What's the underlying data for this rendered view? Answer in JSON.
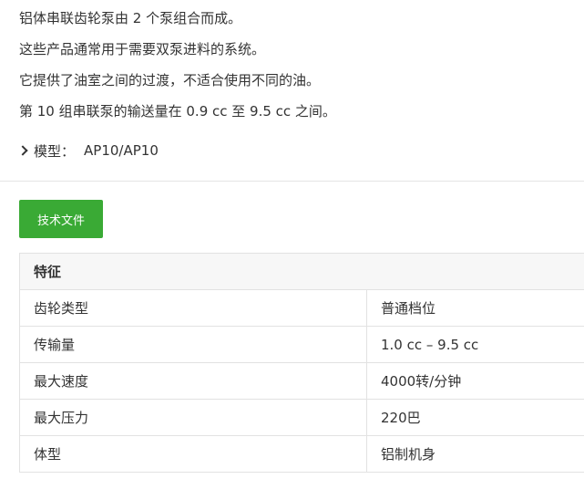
{
  "description": {
    "lines": [
      "铝体串联齿轮泵由 2 个泵组合而成。",
      "这些产品通常用于需要双泵进料的系统。",
      "它提供了油室之间的过渡，不适合使用不同的油。",
      "第 10 组串联泵的输送量在 0.9 cc 至 9.5 cc 之间。"
    ]
  },
  "model": {
    "label": "模型：",
    "value": "AP10/AP10"
  },
  "button": {
    "label": "技术文件",
    "color": "#3aaa35"
  },
  "features": {
    "header": "特征",
    "rows": [
      {
        "name": "齿轮类型",
        "value": "普通档位"
      },
      {
        "name": "传输量",
        "value": "1.0 cc – 9.5 cc"
      },
      {
        "name": "最大速度",
        "value": "4000转/分钟"
      },
      {
        "name": "最大压力",
        "value": "220巴"
      },
      {
        "name": "体型",
        "value": "铝制机身"
      }
    ]
  }
}
